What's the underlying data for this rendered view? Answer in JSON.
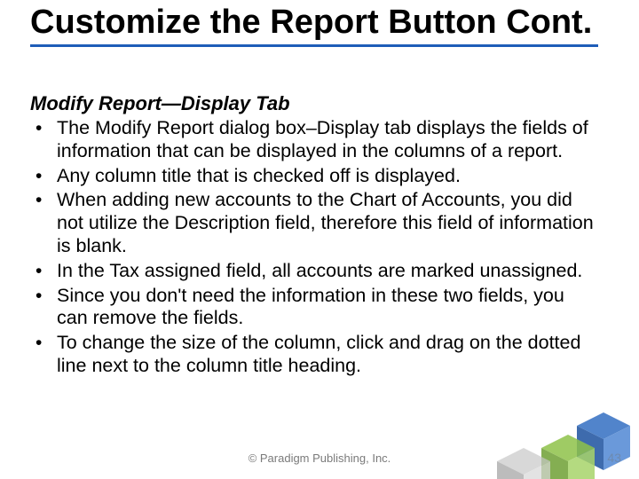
{
  "title": "Customize the Report Button Cont.",
  "subhead": "Modify Report—Display Tab",
  "bullets": [
    "The Modify Report dialog box–Display tab displays the fields of information that can be displayed in the columns of a report.",
    "Any column title that is checked off is displayed.",
    "When adding new accounts to the Chart of Accounts, you did not utilize the Description field, therefore this field of information is blank.",
    "In the Tax assigned field, all accounts are marked unassigned.",
    "Since you don't need the information in these two fields, you can remove the fields.",
    "To change the size of the column, click and drag on the dotted line next to the column title heading."
  ],
  "footer": "© Paradigm Publishing, Inc.",
  "page_number": "43"
}
